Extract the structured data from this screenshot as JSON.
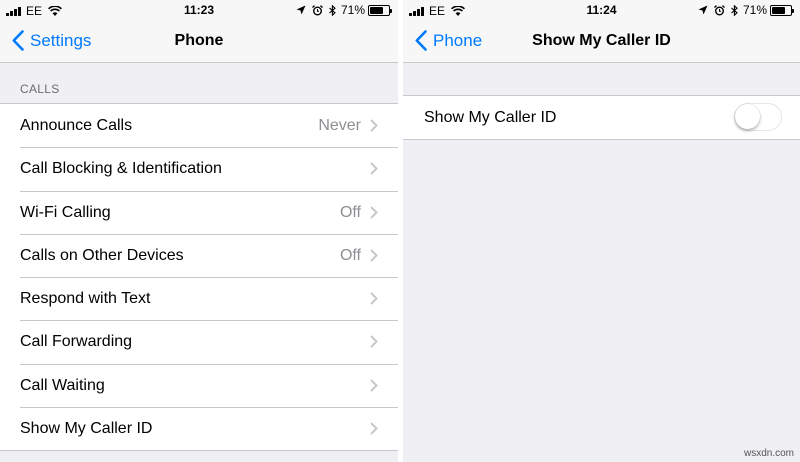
{
  "left": {
    "status": {
      "carrier": "EE",
      "time": "11:23",
      "battery": "71%",
      "battery_level": 0.71
    },
    "nav": {
      "back_label": "Settings",
      "title": "Phone"
    },
    "section_header": "CALLS",
    "rows": [
      {
        "label": "Announce Calls",
        "value": "Never"
      },
      {
        "label": "Call Blocking & Identification",
        "value": ""
      },
      {
        "label": "Wi-Fi Calling",
        "value": "Off"
      },
      {
        "label": "Calls on Other Devices",
        "value": "Off"
      },
      {
        "label": "Respond with Text",
        "value": ""
      },
      {
        "label": "Call Forwarding",
        "value": ""
      },
      {
        "label": "Call Waiting",
        "value": ""
      },
      {
        "label": "Show My Caller ID",
        "value": ""
      }
    ]
  },
  "right": {
    "status": {
      "carrier": "EE",
      "time": "11:24",
      "battery": "71%",
      "battery_level": 0.71
    },
    "nav": {
      "back_label": "Phone",
      "title": "Show My Caller ID"
    },
    "setting": {
      "label": "Show My Caller ID",
      "enabled": false
    }
  },
  "colors": {
    "accent": "#007aff",
    "background": "#efeff4",
    "secondary_text": "#8e8e93",
    "separator": "#c8c7cc"
  },
  "icons": [
    "signal-bars-icon",
    "wifi-icon",
    "location-arrow-icon",
    "alarm-clock-icon",
    "bluetooth-icon",
    "battery-icon",
    "back-chevron-icon",
    "disclosure-chevron-icon"
  ],
  "watermark": "wsxdn.com"
}
